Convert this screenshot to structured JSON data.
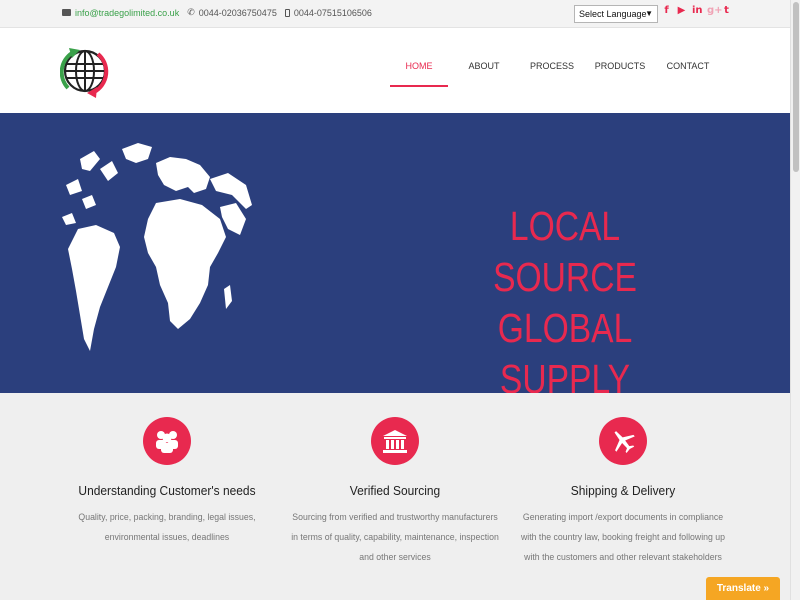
{
  "topbar": {
    "email": "info@tradegolimited.co.uk",
    "phone": "0044-02036750475",
    "mobile": "0044-07515106506",
    "language_select": "Select Language",
    "social_icons": [
      "facebook-icon",
      "youtube-icon",
      "linkedin-icon",
      "google-plus-icon",
      "twitter-icon"
    ],
    "social_glyphs": [
      "f",
      "▶",
      "in",
      "g+",
      "t"
    ]
  },
  "nav": {
    "items": [
      {
        "label": "HOME",
        "active": true
      },
      {
        "label": "ABOUT",
        "active": false
      },
      {
        "label": "PROCESS",
        "active": false
      },
      {
        "label": "PRODUCTS",
        "active": false
      },
      {
        "label": "CONTACT",
        "active": false
      }
    ]
  },
  "hero": {
    "line1": "LOCAL SOURCE",
    "line2": "GLOBAL SUPPLY"
  },
  "features": [
    {
      "icon": "users-icon",
      "title": "Understanding Customer's needs",
      "desc_lines": [
        "Quality, price, packing, branding, legal issues,",
        "environmental issues, deadlines"
      ]
    },
    {
      "icon": "bank-building-icon",
      "title": "Verified Sourcing",
      "desc_lines": [
        "Sourcing from verified and trustworthy manufacturers",
        "in terms of quality, capability, maintenance, inspection",
        "and other services"
      ]
    },
    {
      "icon": "airplane-icon",
      "title": "Shipping & Delivery",
      "desc_lines": [
        "Generating import /export documents in compliance",
        "with the country law, booking freight and following up",
        "with the customers and other relevant stakeholders"
      ]
    }
  ],
  "translate_button": "Translate »",
  "colors": {
    "accent": "#e8294f",
    "hero_bg": "#2b3f7d",
    "green": "#3aa14a",
    "translate": "#f5a623"
  }
}
